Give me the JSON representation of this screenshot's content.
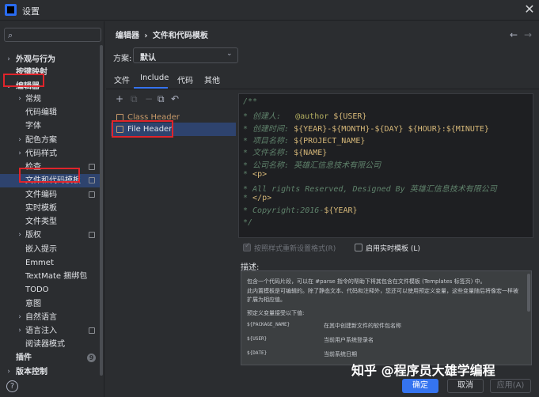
{
  "window": {
    "title": "设置",
    "close_glyph": "✕"
  },
  "sidebar": {
    "search_icon": "⌕",
    "items": [
      {
        "label": "外观与行为",
        "arrow": "›",
        "bold": true
      },
      {
        "label": "按键映射",
        "arrow": "",
        "bold": true
      },
      {
        "label": "编辑器",
        "arrow": "⌄",
        "bold": true
      },
      {
        "label": "常规",
        "arrow": "›",
        "bold": false
      },
      {
        "label": "代码编辑",
        "arrow": "",
        "bold": false
      },
      {
        "label": "字体",
        "arrow": "",
        "bold": false
      },
      {
        "label": "配色方案",
        "arrow": "›",
        "bold": false
      },
      {
        "label": "代码样式",
        "arrow": "›",
        "bold": false
      },
      {
        "label": "检查",
        "arrow": "",
        "bold": false
      },
      {
        "label": "文件和代码模板",
        "arrow": "",
        "bold": false
      },
      {
        "label": "文件编码",
        "arrow": "",
        "bold": false
      },
      {
        "label": "实时模板",
        "arrow": "",
        "bold": false
      },
      {
        "label": "文件类型",
        "arrow": "",
        "bold": false
      },
      {
        "label": "版权",
        "arrow": "›",
        "bold": false
      },
      {
        "label": "嵌入提示",
        "arrow": "",
        "bold": false
      },
      {
        "label": "Emmet",
        "arrow": "",
        "bold": false
      },
      {
        "label": "TextMate 捆绑包",
        "arrow": "",
        "bold": false
      },
      {
        "label": "TODO",
        "arrow": "",
        "bold": false
      },
      {
        "label": "意图",
        "arrow": "",
        "bold": false
      },
      {
        "label": "自然语言",
        "arrow": "›",
        "bold": false
      },
      {
        "label": "语言注入",
        "arrow": "›",
        "bold": false
      },
      {
        "label": "阅读器模式",
        "arrow": "",
        "bold": false
      },
      {
        "label": "插件",
        "arrow": "",
        "bold": true,
        "count": "9"
      },
      {
        "label": "版本控制",
        "arrow": "›",
        "bold": true
      }
    ],
    "help_glyph": "?"
  },
  "breadcrumb": {
    "root": "编辑器",
    "sep": "›",
    "current": "文件和代码模板"
  },
  "nav": {
    "back": "←",
    "forward": "→"
  },
  "scheme": {
    "label": "方案:",
    "value": "默认",
    "chevron": "⌄"
  },
  "tabs": [
    "文件",
    "Include",
    "代码",
    "其他"
  ],
  "toolbar": {
    "add": "+",
    "copy": "⧉",
    "remove": "−",
    "duplicate": "⧉",
    "reset": "↶"
  },
  "templates": [
    {
      "name": "Class Header",
      "faded": true
    },
    {
      "name": "File Header",
      "faded": false
    }
  ],
  "editor": {
    "lines": [
      {
        "pre": "/**",
        "mid": "",
        "var": "",
        "post": ""
      },
      {
        "pre": "* 创建人:   ",
        "mid": "@author ",
        "var": "${USER}",
        "post": ""
      },
      {
        "pre": "* 创建时间: ",
        "mid": "",
        "var": "${YEAR}-${MONTH}-${DAY} ${HOUR}:${MINUTE}",
        "post": ""
      },
      {
        "pre": "* 项目名称: ",
        "mid": "",
        "var": "${PROJECT_NAME}",
        "post": ""
      },
      {
        "pre": "* 文件名称: ",
        "mid": "",
        "var": "${NAME}",
        "post": ""
      },
      {
        "pre": "* 公司名称: 英雄汇信息技术有限公司",
        "mid": "",
        "var": "",
        "post": ""
      },
      {
        "pre": "* ",
        "mid": "",
        "var": "<p>",
        "post": ""
      },
      {
        "pre": "* All rights Reserved, Designed By 英雄汇信息技术有限公司",
        "mid": "",
        "var": "",
        "post": ""
      },
      {
        "pre": "* ",
        "mid": "",
        "var": "</p>",
        "post": ""
      },
      {
        "pre": "* Copyright:2016-",
        "mid": "",
        "var": "${YEAR}",
        "post": ""
      },
      {
        "pre": "*/",
        "mid": "",
        "var": "",
        "post": ""
      }
    ]
  },
  "options": {
    "reformat": "按照样式重新设置格式(R)",
    "live_templates": "启用实时模板 (L)"
  },
  "description": {
    "label": "描述:",
    "intro_1": "包含一个代码片段，可以在 #parse 指令的帮助下将其包含在文件模板 (Templates 标签页) 中。",
    "intro_2": "此内置模板是可编辑的。除了静态文本、代码和注释外，您还可以使用预定义变量，这些变量随后将像宏一样被",
    "intro_3": "扩展为相应值。",
    "vars_title": "预定义变量接受以下值:",
    "vars": [
      {
        "name": "${PACKAGE_NAME}",
        "desc": "在其中创建新文件的软件包名称"
      },
      {
        "name": "${USER}",
        "desc": "当前用户系统登录名"
      },
      {
        "name": "${DATE}",
        "desc": "当前系统日期"
      }
    ]
  },
  "buttons": {
    "ok": "确定",
    "cancel": "取消",
    "apply": "应用(A)"
  },
  "watermark": "知乎 @程序员大雄学编程"
}
